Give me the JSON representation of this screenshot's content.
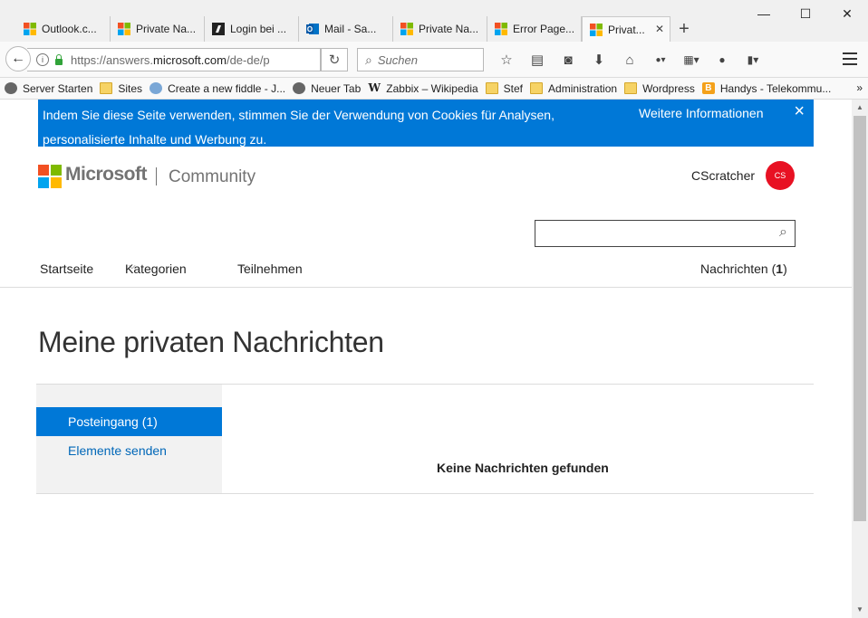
{
  "browser": {
    "tabs": [
      {
        "label": "Outlook.c...",
        "icon": "ms-logo-icon"
      },
      {
        "label": "Private Na...",
        "icon": "ms-logo-icon"
      },
      {
        "label": "Login bei ...",
        "icon": "login-icon"
      },
      {
        "label": "Mail - Sa...",
        "icon": "outlook-icon"
      },
      {
        "label": "Private Na...",
        "icon": "ms-logo-icon"
      },
      {
        "label": "Error Page...",
        "icon": "ms-logo-icon"
      }
    ],
    "active_tab": {
      "label": "Privat...",
      "icon": "ms-logo-icon"
    },
    "new_tab": "+",
    "url_prefix": "https://answers.",
    "url_domain": "microsoft.com",
    "url_suffix": "/de-de/p",
    "search_placeholder": "Suchen",
    "bookmarks": [
      {
        "label": "Server Starten",
        "icon": "globe"
      },
      {
        "label": "Sites",
        "icon": "folder"
      },
      {
        "label": "Create a new fiddle - J...",
        "icon": "globe"
      },
      {
        "label": "Neuer Tab",
        "icon": "globe"
      },
      {
        "label": "Zabbix – Wikipedia",
        "icon": "w"
      },
      {
        "label": "Stef",
        "icon": "folder"
      },
      {
        "label": "Administration",
        "icon": "folder"
      },
      {
        "label": "Wordpress",
        "icon": "folder"
      },
      {
        "label": "Handys - Telekommu...",
        "icon": "b"
      }
    ],
    "bookmarks_more": "»"
  },
  "cookie_banner": {
    "message": "Indem Sie diese Seite verwenden, stimmen Sie der Verwendung von Cookies für Analysen, personalisierte Inhalte und Werbung zu.",
    "more_link": "Weitere Informationen",
    "close": "×"
  },
  "header": {
    "brand": "Microsoft",
    "product": "Community",
    "username": "CScratcher",
    "avatar_initials": "CS"
  },
  "nav": {
    "home": "Startseite",
    "categories": "Kategorien",
    "participate": "Teilnehmen",
    "messages_label": "Nachrichten (",
    "messages_count": "1",
    "messages_close": ")"
  },
  "page": {
    "title": "Meine privaten Nachrichten",
    "sidebar": [
      {
        "label": "Posteingang (1)",
        "active": true
      },
      {
        "label": "Elemente senden",
        "active": false
      }
    ],
    "empty_message": "Keine Nachrichten gefunden"
  },
  "colors": {
    "accent": "#0078d7",
    "link": "#0067b8",
    "avatar": "#e81123",
    "ms_red": "#f25022",
    "ms_green": "#7fba00",
    "ms_blue": "#00a4ef",
    "ms_yellow": "#ffb900"
  }
}
